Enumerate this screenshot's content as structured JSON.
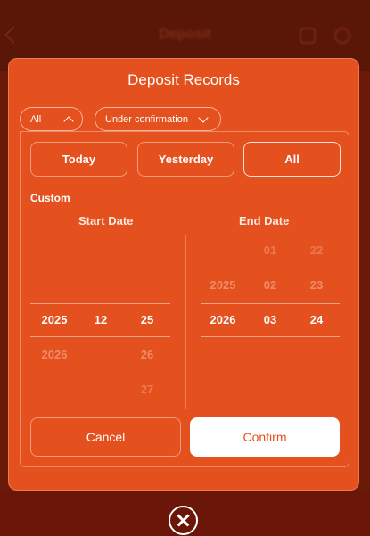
{
  "background": {
    "title": "Deposit",
    "colors": {
      "overlay": "#6b1a08",
      "modal": "#e4501e",
      "confirm_text": "#e4501e"
    }
  },
  "modal": {
    "title": "Deposit Records",
    "filters": {
      "type": {
        "value": "All",
        "icon": "chevron-up-icon"
      },
      "status": {
        "value": "Under confirmation",
        "icon": "chevron-down-icon"
      }
    },
    "quick_ranges": [
      "Today",
      "Yesterday",
      "All"
    ],
    "selected_range": "All",
    "custom_label": "Custom",
    "start_date": {
      "title": "Start Date",
      "years": {
        "selected": "2025",
        "below": [
          "2026"
        ]
      },
      "months": {
        "selected": "12"
      },
      "days": {
        "selected": "25",
        "below": [
          "26",
          "27"
        ]
      }
    },
    "end_date": {
      "title": "End Date",
      "years": {
        "above": [
          "2025"
        ],
        "selected": "2026"
      },
      "months": {
        "above": [
          "01",
          "02"
        ],
        "selected": "03"
      },
      "days": {
        "above": [
          "22",
          "23"
        ],
        "selected": "24"
      }
    },
    "cancel_label": "Cancel",
    "confirm_label": "Confirm"
  },
  "close_icon": "close-circle-icon"
}
